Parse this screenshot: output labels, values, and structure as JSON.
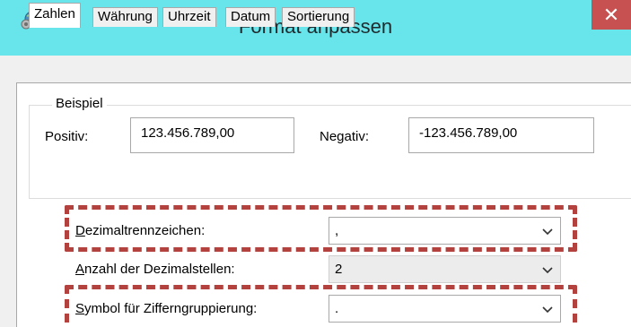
{
  "window": {
    "title": "Format anpassen",
    "close_glyph": "✕"
  },
  "tabs": [
    {
      "label": "Zahlen",
      "active": true
    },
    {
      "label": "Währung",
      "active": false
    },
    {
      "label": "Uhrzeit",
      "active": false
    },
    {
      "label": "Datum",
      "active": false
    },
    {
      "label": "Sortierung",
      "active": false
    }
  ],
  "example": {
    "legend": "Beispiel",
    "positive_label": "Positiv:",
    "positive_value": "123.456.789,00",
    "negative_label": "Negativ:",
    "negative_value": "-123.456.789,00"
  },
  "settings": [
    {
      "label": "Dezimaltrennzeichen:",
      "value": ",",
      "highlighted": true
    },
    {
      "label": "Anzahl der Dezimalstellen:",
      "value": "2",
      "highlighted": false
    },
    {
      "label": "Symbol für Zifferngruppierung:",
      "value": ".",
      "highlighted": true
    }
  ],
  "colors": {
    "titlebar": "#67e5ea",
    "close_button": "#c75050",
    "highlight": "#b3423e"
  },
  "icons": {
    "app": "globe-gear-icon",
    "close": "close-icon",
    "dropdown": "chevron-down-icon"
  }
}
